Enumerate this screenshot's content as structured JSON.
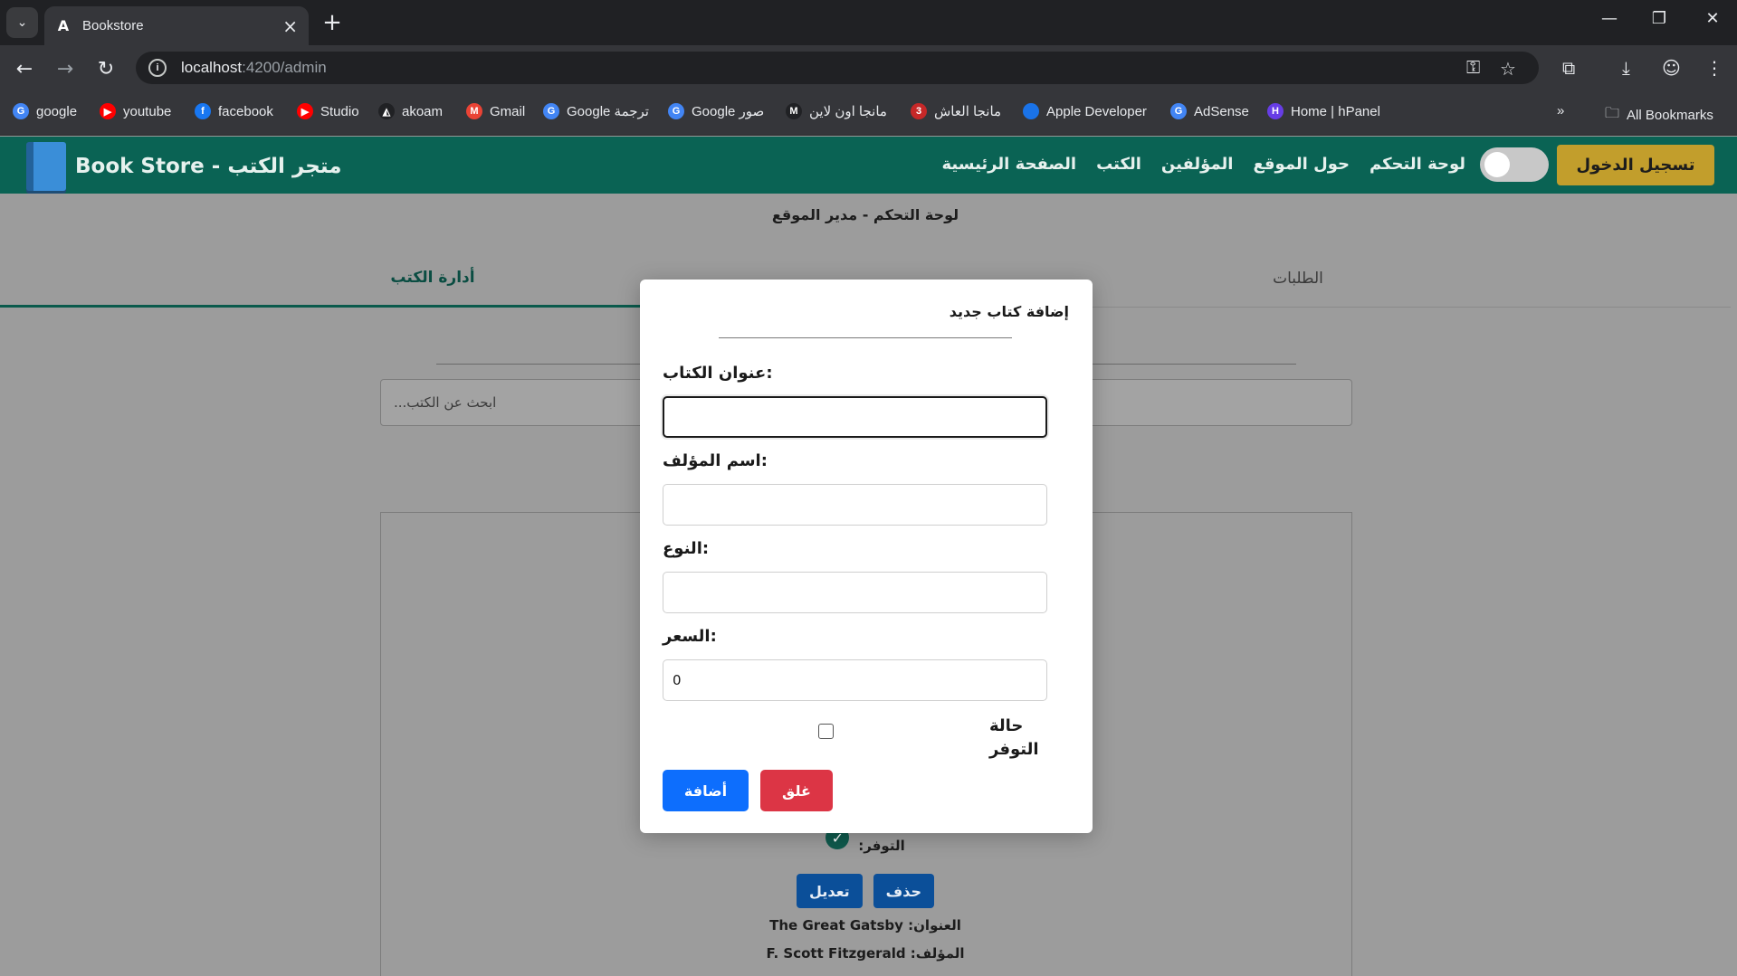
{
  "browser": {
    "tab_title": "Bookstore",
    "tab_favicon": "A",
    "url_host": "localhost",
    "url_path": ":4200/admin",
    "bookmarks": [
      {
        "label": "google",
        "icon": "G",
        "color": "#4285f4"
      },
      {
        "label": "youtube",
        "icon": "▶",
        "color": "#ff0000"
      },
      {
        "label": "facebook",
        "icon": "f",
        "color": "#1877f2"
      },
      {
        "label": "Studio",
        "icon": "▶",
        "color": "#ff0000"
      },
      {
        "label": "akoam",
        "icon": "◭",
        "color": "#202124"
      },
      {
        "label": "Gmail",
        "icon": "M",
        "color": "#ea4335"
      },
      {
        "label": "Google ترجمة",
        "icon": "G",
        "color": "#4285f4"
      },
      {
        "label": "Google صور",
        "icon": "G",
        "color": "#4285f4"
      },
      {
        "label": "مانجا اون لاين",
        "icon": "M",
        "color": "#202124"
      },
      {
        "label": "مانجا العاش",
        "icon": "3",
        "color": "#c62828"
      },
      {
        "label": "Apple Developer",
        "icon": "",
        "color": "#1a73e8"
      },
      {
        "label": "AdSense",
        "icon": "G",
        "color": "#4285f4"
      },
      {
        "label": "Home | hPanel",
        "icon": "H",
        "color": "#673de6"
      }
    ],
    "all_bookmarks": "All Bookmarks"
  },
  "app": {
    "brand": "Book Store - متجر الكتب",
    "nav": [
      "لوحة التحكم",
      "حول الموقع",
      "المؤلفين",
      "الكتب",
      "الصفحة الرئيسية"
    ],
    "login": "تسجيل الدخول"
  },
  "admin": {
    "title": "لوحة التحكم - مدير الموقع",
    "tab_manage": "أدارة الكتب",
    "tab_orders": "الطلبات",
    "search_placeholder": "ابحث عن الكتب...",
    "availability_label": "التوفر:",
    "delete": "حذف",
    "edit": "تعديل",
    "title_line": "العنوان: The Great Gatsby",
    "author_line": "المؤلف: F. Scott Fitzgerald"
  },
  "modal": {
    "title": "إضافة كتاب جديد",
    "book_title_label": "عنوان الكتاب:",
    "book_title_value": "",
    "author_label": "اسم المؤلف:",
    "author_value": "",
    "genre_label": "النوع:",
    "genre_value": "",
    "price_label": "السعر:",
    "price_value": "0",
    "availability_label": "حالة التوفر",
    "availability_checked": false,
    "add_button": "أضافة",
    "close_button": "غلق"
  }
}
